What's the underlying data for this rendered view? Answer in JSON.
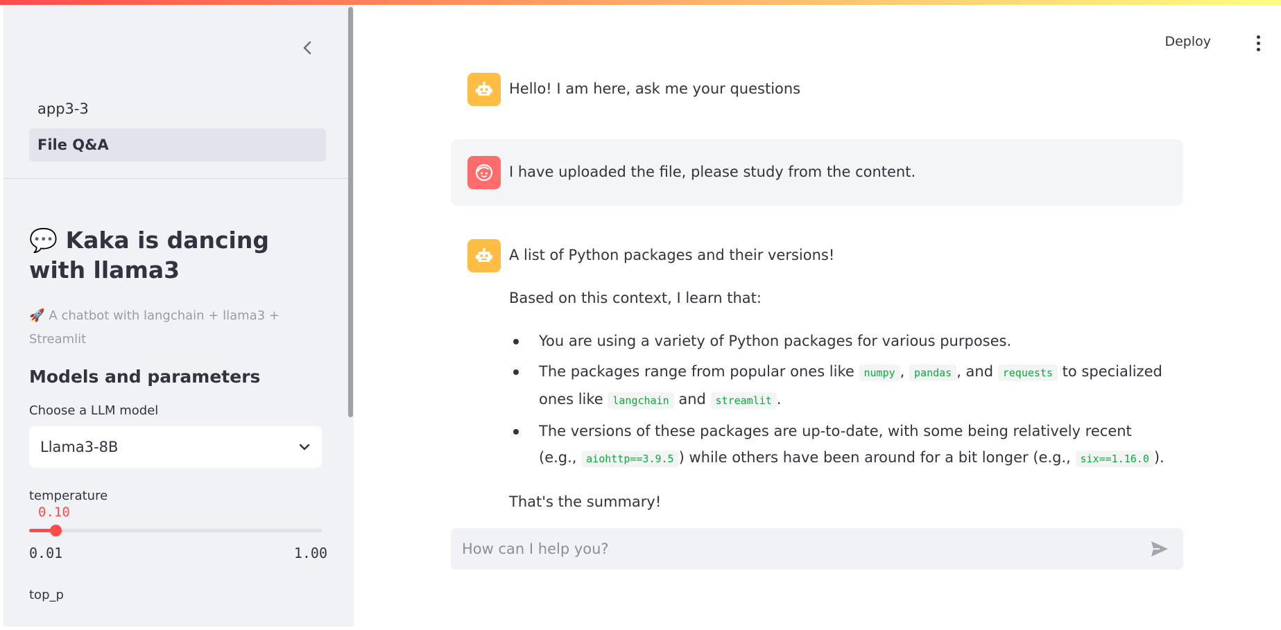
{
  "sidebar": {
    "nav": [
      {
        "label": "app3-3",
        "active": false
      },
      {
        "label": "File Q&A",
        "active": true
      }
    ],
    "title_emoji": "💬",
    "title": "Kaka is dancing with llama3",
    "caption_emoji": "🚀",
    "caption": "A chatbot with langchain + llama3 + Streamlit",
    "section_heading": "Models and parameters",
    "model_select": {
      "label": "Choose a LLM model",
      "value": "Llama3-8B"
    },
    "temperature": {
      "label": "temperature",
      "value": "0.10",
      "min": "0.01",
      "max": "1.00",
      "fraction": 0.091
    },
    "top_p": {
      "label": "top_p"
    }
  },
  "header": {
    "deploy_label": "Deploy"
  },
  "chat": {
    "msg1": {
      "role": "assistant",
      "text": "Hello! I am here, ask me your questions"
    },
    "msg2": {
      "role": "user",
      "text": "I have uploaded the file, please study from the content."
    },
    "msg3": {
      "role": "assistant",
      "intro": "A list of Python packages and their versions!",
      "context": "Based on this context, I learn that:",
      "bullet1": "You are using a variety of Python packages for various purposes.",
      "bullet2": {
        "t1": "The packages range from popular ones like ",
        "c1": "numpy",
        "t2": ", ",
        "c2": "pandas",
        "t3": ", and ",
        "c3": "requests",
        "t4": " to specialized ones like ",
        "c4": "langchain",
        "t5": " and ",
        "c5": "streamlit",
        "t6": "."
      },
      "bullet3": {
        "t1": "The versions of these packages are up-to-date, with some being relatively recent (e.g., ",
        "c1": "aiohttp==3.9.5",
        "t2": ") while others have been around for a bit longer (e.g., ",
        "c2": "six==1.16.0",
        "t3": ")."
      },
      "summary": "That's the summary!"
    },
    "input_placeholder": "How can I help you?"
  },
  "colors": {
    "accent": "#ff4b4b",
    "bot_avatar": "#ffbd45",
    "user_avatar": "#ff6c6c",
    "code_text": "#09ab3b"
  }
}
